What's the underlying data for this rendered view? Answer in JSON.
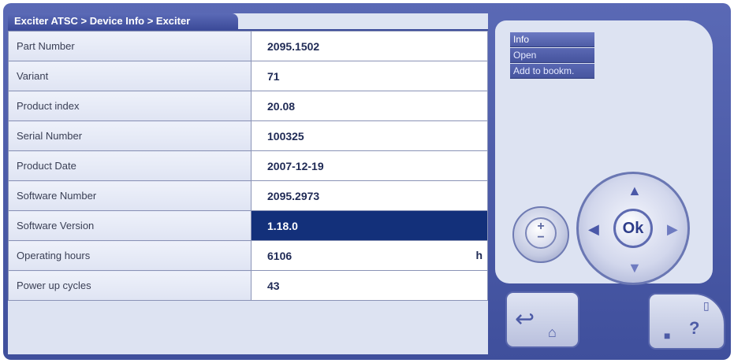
{
  "breadcrumb": "Exciter ATSC > Device Info > Exciter",
  "rows": [
    {
      "label": "Part Number",
      "value": "2095.1502",
      "unit": ""
    },
    {
      "label": "Variant",
      "value": "71",
      "unit": ""
    },
    {
      "label": "Product index",
      "value": "20.08",
      "unit": ""
    },
    {
      "label": "Serial Number",
      "value": "100325",
      "unit": ""
    },
    {
      "label": "Product Date",
      "value": "2007-12-19",
      "unit": ""
    },
    {
      "label": "Software Number",
      "value": "2095.2973",
      "unit": ""
    },
    {
      "label": "Software Version",
      "value": "1.18.0",
      "unit": "",
      "selected": true
    },
    {
      "label": "Operating hours",
      "value": "6106",
      "unit": "h"
    },
    {
      "label": "Power up cycles",
      "value": "43",
      "unit": ""
    }
  ],
  "menu": {
    "info": "Info",
    "open": "Open",
    "bookmark": "Add to bookm."
  },
  "controls": {
    "ok_label": "Ok",
    "zoom_plus": "+",
    "zoom_minus": "−",
    "help_label": "?"
  },
  "colors": {
    "frame": "#4a59a6",
    "selected_row": "#13307a",
    "panel": "#dde3f2"
  }
}
